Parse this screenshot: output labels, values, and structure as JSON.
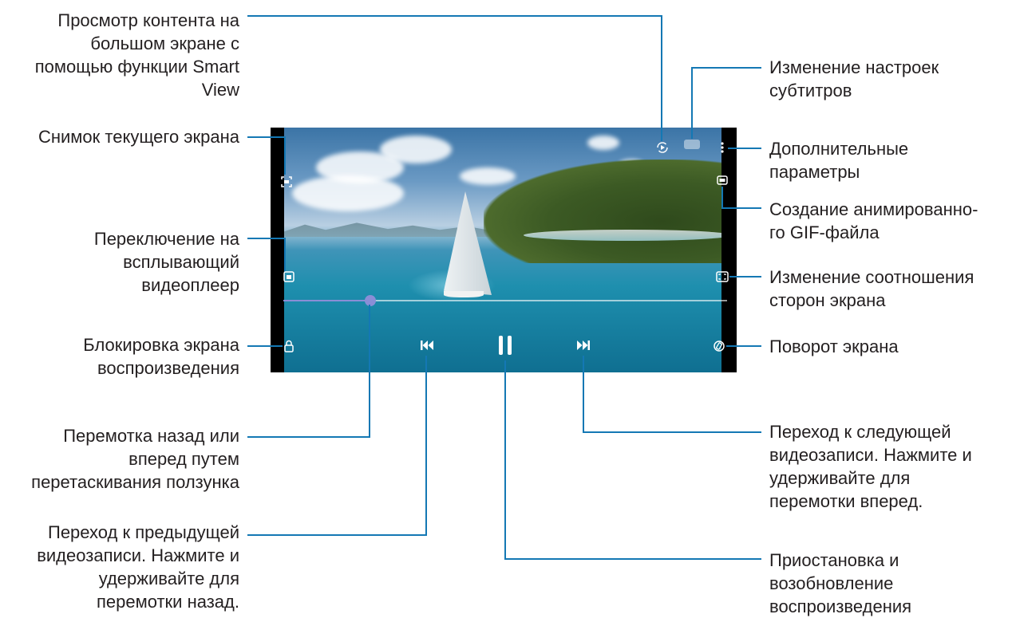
{
  "labels": {
    "smart_view": [
      "Просмотр контента на",
      "большом экране с",
      "помощью функции Smart",
      "View"
    ],
    "screenshot": [
      "Снимок текущего экрана"
    ],
    "popup_player": [
      "Переключение на",
      "всплывающий",
      "видеоплеер"
    ],
    "lock_screen": [
      "Блокировка экрана",
      "воспроизведения"
    ],
    "seek": [
      "Перемотка назад или",
      "вперед путем",
      "перетаскивания ползунка"
    ],
    "previous": [
      "Переход к предыдущей",
      "видеозаписи. Нажмите и",
      "удерживайте для",
      "перемотки назад."
    ],
    "subtitles": [
      "Изменение настроек",
      "субтитров"
    ],
    "more_options": [
      "Дополнительные",
      "параметры"
    ],
    "gif": [
      "Создание анимированно-",
      "го GIF-файла"
    ],
    "aspect_ratio": [
      "Изменение соотношения",
      "сторон экрана"
    ],
    "rotate": [
      "Поворот экрана"
    ],
    "next": [
      "Переход к следующей",
      "видеозаписи. Нажмите и",
      "удерживайте для",
      "перемотки вперед."
    ],
    "pause": [
      "Приостановка и",
      "возобновление",
      "воспроизведения"
    ]
  },
  "player": {
    "progress_percent": 19.6,
    "accent_color": "#8a8ed6",
    "callout_color": "#1478b4"
  },
  "icons": [
    "smart-view-icon",
    "subtitle-icon",
    "more-options-icon",
    "screenshot-icon",
    "gif-icon",
    "popup-player-icon",
    "aspect-ratio-icon",
    "lock-icon",
    "rotate-icon",
    "previous-icon",
    "pause-icon",
    "next-icon"
  ]
}
